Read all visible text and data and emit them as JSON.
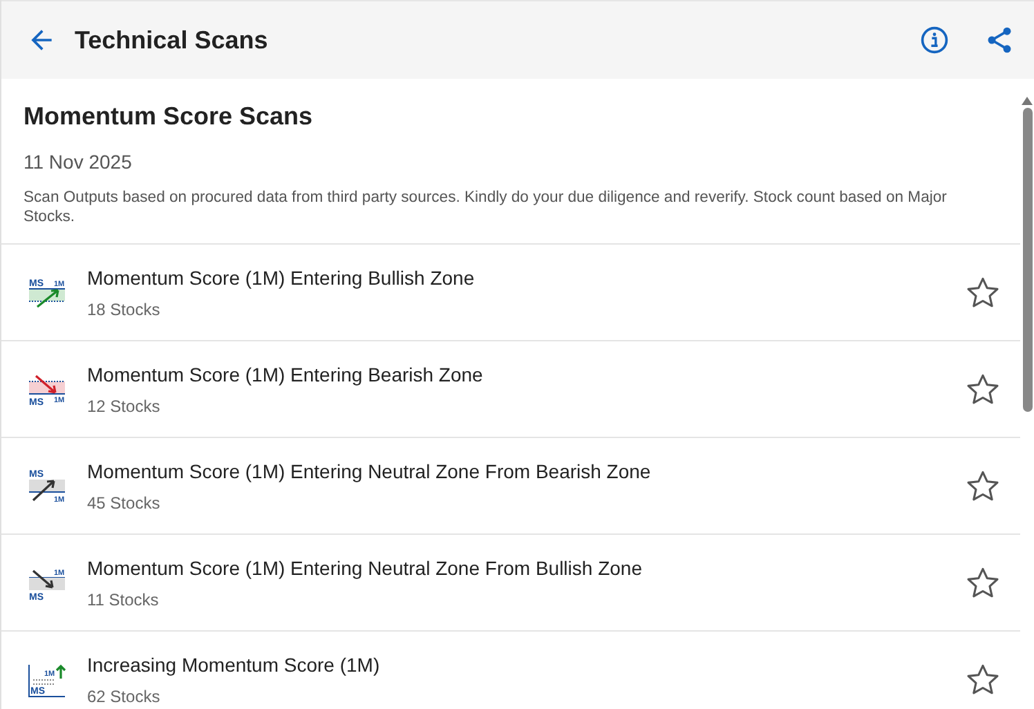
{
  "header": {
    "title": "Technical Scans"
  },
  "section": {
    "title": "Momentum Score Scans",
    "date": "11 Nov 2025",
    "disclaimer": "Scan Outputs based on procured data from third party sources. Kindly do your due diligence and reverify. Stock count based on Major Stocks."
  },
  "scans": [
    {
      "title": "Momentum Score (1M) Entering Bullish Zone",
      "count": "18 Stocks",
      "starred": false,
      "icon": {
        "kind": "bullish",
        "score_label": "MS",
        "period_label": "1M"
      }
    },
    {
      "title": "Momentum Score (1M) Entering Bearish Zone",
      "count": "12 Stocks",
      "starred": false,
      "icon": {
        "kind": "bearish",
        "score_label": "MS",
        "period_label": "1M"
      }
    },
    {
      "title": "Momentum Score (1M) Entering Neutral Zone From Bearish Zone",
      "count": "45 Stocks",
      "starred": false,
      "icon": {
        "kind": "neutral_up",
        "score_label": "MS",
        "period_label": "1M"
      }
    },
    {
      "title": "Momentum Score (1M) Entering Neutral Zone From Bullish Zone",
      "count": "11 Stocks",
      "starred": false,
      "icon": {
        "kind": "neutral_down",
        "score_label": "MS",
        "period_label": "1M"
      }
    },
    {
      "title": "Increasing Momentum Score (1M)",
      "count": "62 Stocks",
      "starred": false,
      "icon": {
        "kind": "increasing",
        "score_label": "MS",
        "period_label": "1M"
      }
    }
  ]
}
